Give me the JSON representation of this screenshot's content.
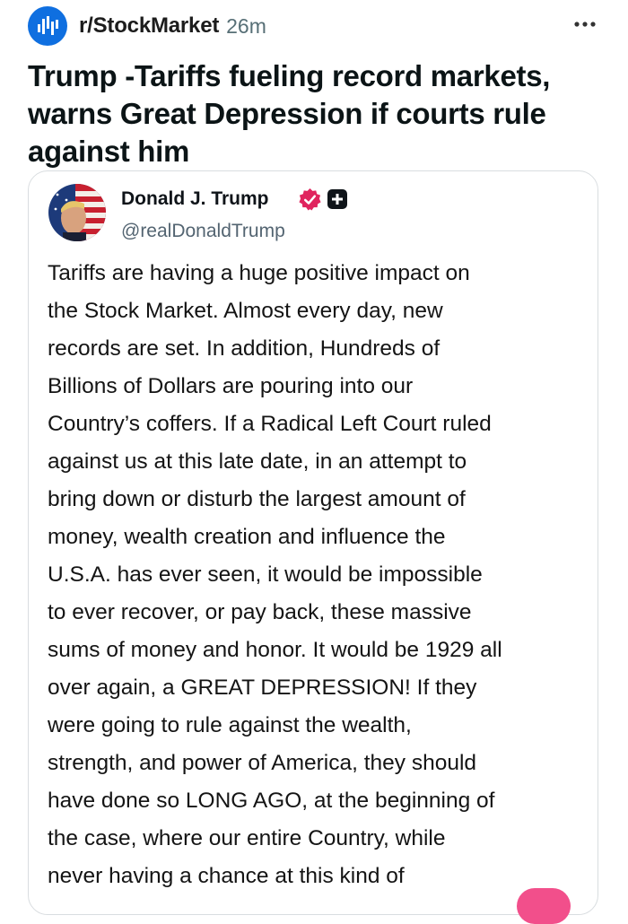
{
  "post": {
    "subreddit": "r/StockMarket",
    "time": "26m",
    "more_icon": "ellipsis-icon",
    "title": "Trump -Tariffs fueling record markets, warns Great Depression if courts rule against him"
  },
  "embed": {
    "author_name": "Donald J. Trump",
    "author_handle": "@realDonaldTrump",
    "verified_icon": "verified-badge-icon",
    "verified_color": "#e0245e",
    "plus_icon": "plus-square-icon",
    "body_lines": [
      "Tariffs are having a huge positive impact on",
      "the Stock Market. Almost every day, new",
      "records are set. In addition, Hundreds of",
      "Billions of Dollars are pouring into our",
      "Country’s coffers. If a Radical Left Court ruled",
      "against us at this late date, in an attempt to",
      "bring down or disturb the largest amount of",
      "money, wealth creation and influence the",
      "U.S.A. has ever seen, it would be impossible",
      "to ever recover, or pay back, these massive",
      "sums of money and honor. It would be 1929 all",
      "over again, a GREAT DEPRESSION! If they",
      "were going to rule against the wealth,",
      "strength, and power of America, they should",
      "have done so LONG AGO, at the beginning of",
      "the case, where our entire Country, while",
      "never having a chance at this kind of"
    ]
  },
  "colors": {
    "subreddit_icon_bg": "#0f6fe0",
    "accent_pink": "#f24f8b"
  }
}
